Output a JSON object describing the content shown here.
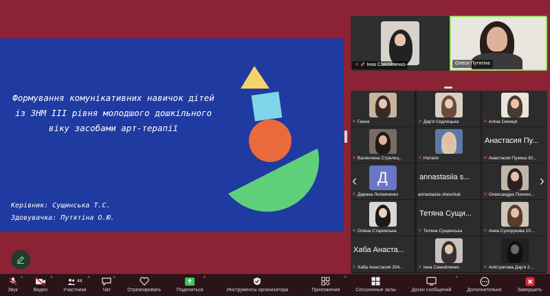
{
  "slide": {
    "title": "Формування комунікативних навичок дітей із ЗНМ ІІІ рівня молодшого дошкільного віку засобами арт-терапії",
    "supervisor": "Керівник: Сущинська Т.С.",
    "applicant": "Здовувачка: Путятіна О.Ю.",
    "colors": {
      "background": "#1f3aa0",
      "triangle": "#f4d36b",
      "square": "#7fd4e8",
      "circle": "#ea6a3c",
      "bowl": "#5fd07a"
    }
  },
  "top_gallery": [
    {
      "name": "Інна Самойленко",
      "muted": true
    },
    {
      "name": "Олеся Путятіна",
      "muted": false,
      "active_speaker": true
    }
  ],
  "gallery": [
    {
      "label": "Ганна",
      "display": "photo",
      "muted": true
    },
    {
      "label": "Дар'я Седлецька",
      "display": "photo",
      "muted": true
    },
    {
      "label": "Аліна Синиця",
      "display": "photo",
      "muted": true
    },
    {
      "label": "Валентина Стрелец...",
      "display": "photo",
      "muted": true
    },
    {
      "label": "Наталя",
      "display": "photo",
      "muted": true
    },
    {
      "label": "Анастасия Пузина 30...",
      "display": "text",
      "big_name": "Анастасия Пу...",
      "muted": true
    },
    {
      "label": "Дарина Литвиченко",
      "display": "avatar",
      "letter": "Д",
      "muted": true
    },
    {
      "label": "annastasiia shevchuk",
      "display": "text",
      "big_name": "annastasiia s...",
      "muted": false
    },
    {
      "label": "Олександра Поночо...",
      "display": "photo",
      "muted": true
    },
    {
      "label": "Олена Старинська",
      "display": "photo",
      "muted": true
    },
    {
      "label": "Тетяна Сущинська",
      "display": "text",
      "big_name": "Тетяна Сущи...",
      "muted": true
    },
    {
      "label": "Анна Сухорукова 10...",
      "display": "photo",
      "muted": true
    },
    {
      "label": "Хаба Анастасия 204...",
      "display": "text",
      "big_name": "Хаба Анаста...",
      "muted": true
    },
    {
      "label": "Інна Самойленко",
      "display": "photo",
      "muted": true
    },
    {
      "label": "Апістратова Дар'я 2...",
      "display": "photo",
      "muted": true
    }
  ],
  "toolbar": {
    "audio": "Звук",
    "video": "Видео",
    "participants": "Участники",
    "participants_count": "44",
    "chat": "Чат",
    "react": "Отреагировать",
    "share": "Поделиться",
    "host_tools": "Инструменты организатора",
    "apps": "Приложения",
    "breakout": "Сессионные залы",
    "whiteboard": "Доски сообщений",
    "more": "Дополнительно",
    "end": "Завершить"
  },
  "colors": {
    "window_bg": "#8b2335",
    "share_icon": "#3bc35a",
    "end_icon": "#e0283a",
    "active_border": "#9be06c"
  }
}
